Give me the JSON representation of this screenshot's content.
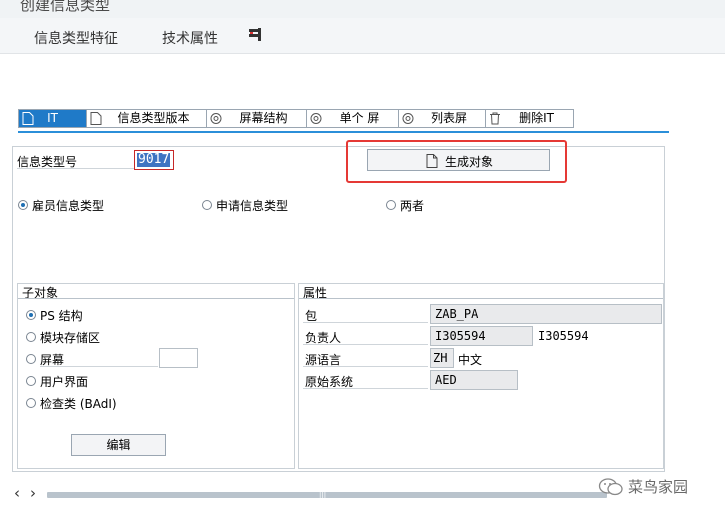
{
  "window": {
    "title": "创建信息类型"
  },
  "menu": {
    "item1": "信息类型特征",
    "item2": "技术属性"
  },
  "tabs": [
    {
      "label": "IT"
    },
    {
      "label": "信息类型版本"
    },
    {
      "label": "屏幕结构"
    },
    {
      "label": "单个 屏"
    },
    {
      "label": "列表屏"
    },
    {
      "label": "删除IT"
    }
  ],
  "form": {
    "infotype_label": "信息类型号",
    "infotype_value": "9017",
    "create_button": "生成对象"
  },
  "infotype_category": {
    "options": [
      "雇员信息类型",
      "申请信息类型",
      "两者"
    ],
    "selected": "雇员信息类型"
  },
  "subobjects": {
    "title": "子对象",
    "options": [
      "PS 结构",
      "模块存储区",
      "屏幕",
      "用户界面",
      "检查类 (BAdI)"
    ],
    "selected": "PS 结构",
    "edit_button": "编辑"
  },
  "attributes": {
    "title": "属性",
    "package_label": "包",
    "package_value": "ZAB_PA",
    "owner_label": "负责人",
    "owner_value": "I305594",
    "owner_display": "I305594",
    "lang_label": "源语言",
    "lang_value": "ZH",
    "lang_text": "中文",
    "system_label": "原始系统",
    "system_value": "AED"
  },
  "scroll": {
    "left_arrow": "‹",
    "right_arrow": "›",
    "grip": "|||"
  },
  "watermark": {
    "text": "菜鸟家园"
  },
  "colors": {
    "accent": "#1f7ac8",
    "highlight_border": "#e53935"
  }
}
